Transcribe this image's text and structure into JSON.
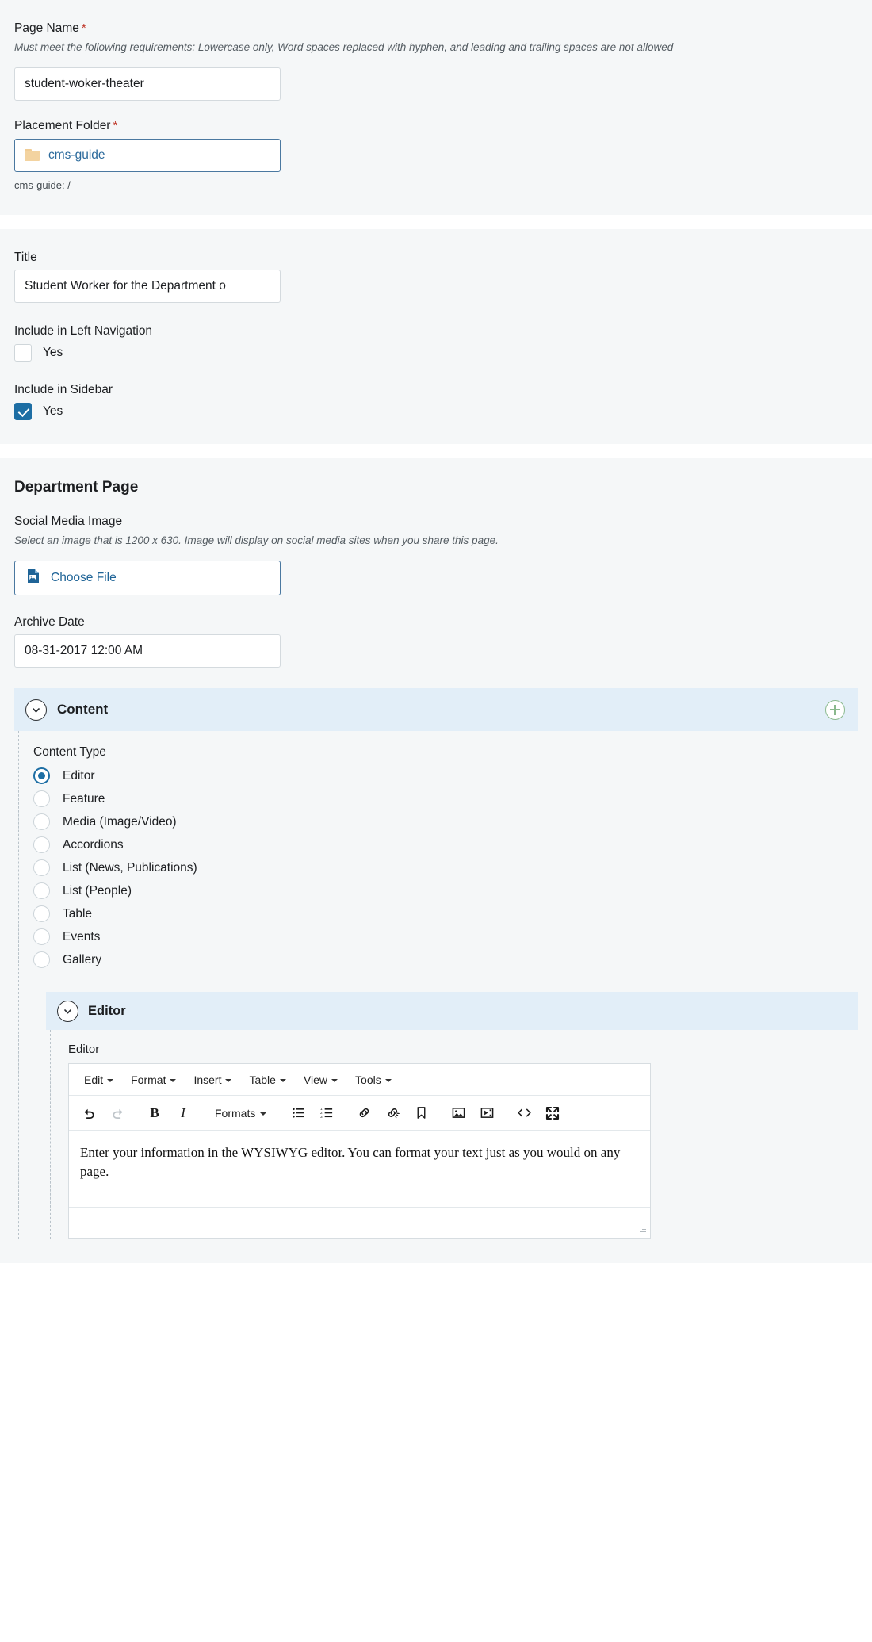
{
  "page_name_section": {
    "label": "Page Name",
    "required_mark": "*",
    "help": "Must meet the following requirements: Lowercase only, Word spaces replaced with hyphen, and leading and trailing spaces are not allowed",
    "value": "student-woker-theater",
    "placeholder": "",
    "placement_label": "Placement Folder",
    "placement_required_mark": "*",
    "placement_value": "cms-guide",
    "placement_note": "cms-guide: /"
  },
  "title_section": {
    "title_label": "Title",
    "title_value": "Student Worker for the Department o",
    "left_nav_label": "Include in Left Navigation",
    "left_nav_option": "Yes",
    "left_nav_checked": false,
    "sidebar_label": "Include in Sidebar",
    "sidebar_option": "Yes",
    "sidebar_checked": true
  },
  "department_section": {
    "heading": "Department Page",
    "social_label": "Social Media Image",
    "social_help": "Select an image that is 1200 x 630. Image will display on social media sites when you share this page.",
    "choose_file_label": "Choose File",
    "archive_label": "Archive Date",
    "archive_value": "08-31-2017 12:00 AM"
  },
  "content_accordion": {
    "title": "Content",
    "add_icon": "plus-circle-icon",
    "collapse_icon": "chevron-down-icon",
    "content_type_label": "Content Type",
    "options": [
      {
        "label": "Editor",
        "selected": true
      },
      {
        "label": "Feature",
        "selected": false
      },
      {
        "label": "Media (Image/Video)",
        "selected": false
      },
      {
        "label": "Accordions",
        "selected": false
      },
      {
        "label": "List (News, Publications)",
        "selected": false
      },
      {
        "label": "List (People)",
        "selected": false
      },
      {
        "label": "Table",
        "selected": false
      },
      {
        "label": "Events",
        "selected": false
      },
      {
        "label": "Gallery",
        "selected": false
      }
    ]
  },
  "editor_accordion": {
    "title": "Editor",
    "sublabel": "Editor",
    "menubar": [
      "Edit",
      "Format",
      "Insert",
      "Table",
      "View",
      "Tools"
    ],
    "formats_label": "Formats",
    "body_text_before": "Enter your information in the WYSIWYG editor.",
    "body_text_after": "You can format your text just as you would on any page.",
    "toolbar_icons": [
      "undo-icon",
      "redo-icon",
      "bold-icon",
      "italic-icon",
      "formats-dropdown",
      "bullet-list-icon",
      "numbered-list-icon",
      "link-icon",
      "unlink-icon",
      "anchor-icon",
      "image-icon",
      "media-icon",
      "source-code-icon",
      "fullscreen-icon"
    ]
  },
  "colors": {
    "panel_bg": "#f5f7f8",
    "accordion_bg": "#e2eef8",
    "accent_blue": "#1d6ea4",
    "link_blue": "#2b6a9c",
    "required_red": "#c0392b",
    "folder_tan": "#f3d3a0",
    "add_green": "#8ab98d"
  }
}
